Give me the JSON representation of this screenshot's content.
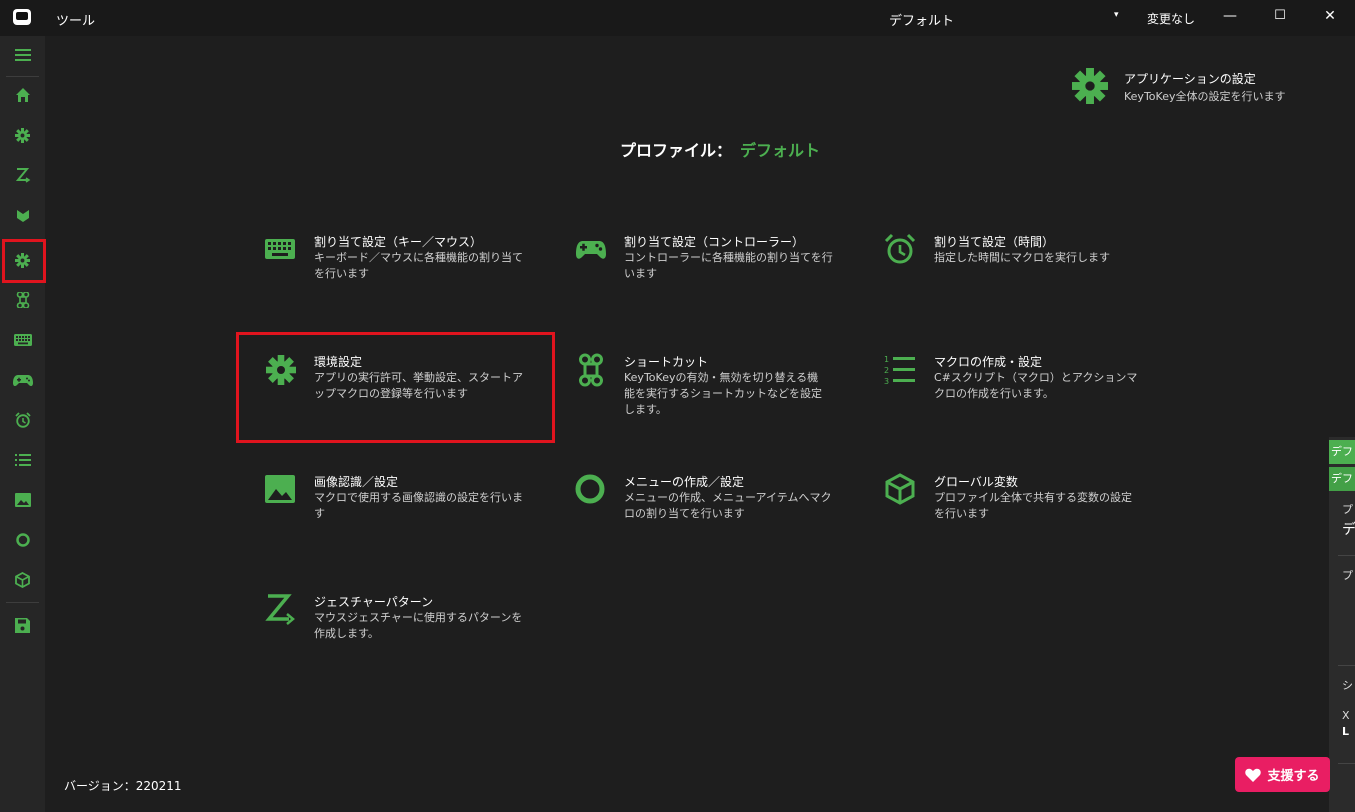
{
  "window": {
    "menu_label": "ツール",
    "profile_name": "デフォルト",
    "dropdown_arrow": "▾",
    "status": "変更なし",
    "minimize": "—",
    "maximize": "☐",
    "close": "✕"
  },
  "sidebar": {
    "items": [
      {
        "icon": "menu-icon"
      },
      {
        "icon": "home-icon"
      },
      {
        "icon": "gear-icon"
      },
      {
        "icon": "gesture-z-icon"
      },
      {
        "icon": "shield-icon"
      },
      {
        "icon": "gear-icon",
        "selected": true
      },
      {
        "icon": "command-icon"
      },
      {
        "icon": "keyboard-icon"
      },
      {
        "icon": "gamepad-icon"
      },
      {
        "icon": "alarm-icon"
      },
      {
        "icon": "list-icon"
      },
      {
        "icon": "image-icon"
      },
      {
        "icon": "ring-icon"
      },
      {
        "icon": "cube-icon"
      },
      {
        "icon": "save-icon"
      }
    ]
  },
  "app_settings": {
    "title": "アプリケーションの設定",
    "description": "KeyToKey全体の設定を行います"
  },
  "profile": {
    "label": "プロファイル：",
    "value": "デフォルト"
  },
  "tiles": [
    {
      "icon": "keyboard-icon",
      "title": "割り当て設定（キー／マウス）",
      "description": "キーボード／マウスに各種機能の割り当てを行います"
    },
    {
      "icon": "gamepad-icon",
      "title": "割り当て設定（コントローラー）",
      "description": "コントローラーに各種機能の割り当てを行います"
    },
    {
      "icon": "alarm-icon",
      "title": "割り当て設定（時間）",
      "description": "指定した時間にマクロを実行します"
    },
    {
      "icon": "gear-icon",
      "title": "環境設定",
      "description": "アプリの実行許可、挙動設定、スタートアップマクロの登録等を行います"
    },
    {
      "icon": "command-icon",
      "title": "ショートカット",
      "description": "KeyToKeyの有効・無効を切り替える機能を実行するショートカットなどを設定します。"
    },
    {
      "icon": "macro-list-icon",
      "title": "マクロの作成・設定",
      "description": "C#スクリプト（マクロ）とアクションマクロの作成を行います。"
    },
    {
      "icon": "image-icon",
      "title": "画像認識／設定",
      "description": "マクロで使用する画像認識の設定を行います"
    },
    {
      "icon": "ring-icon",
      "title": "メニューの作成／設定",
      "description": "メニューの作成、メニューアイテムへマクロの割り当てを行います"
    },
    {
      "icon": "cube-icon",
      "title": "グローバル変数",
      "description": "プロファイル全体で共有する変数の設定を行います"
    },
    {
      "icon": "gesture-z-icon",
      "title": "ジェスチャーパターン",
      "description": "マウスジェスチャーに使用するパターンを作成します。"
    }
  ],
  "version": "バージョン：220211",
  "support": {
    "label": "支援する"
  },
  "right_panel": {
    "tab1": "デフ",
    "tab2": "デフ",
    "t1": "プ",
    "t2": "デ",
    "t3": "プ",
    "t4": "シ",
    "t5": "X",
    "t6": "L"
  },
  "colors": {
    "accent": "#4caf50",
    "highlight": "#e0141e",
    "support": "#e91e63",
    "background": "#1e1e1e"
  }
}
